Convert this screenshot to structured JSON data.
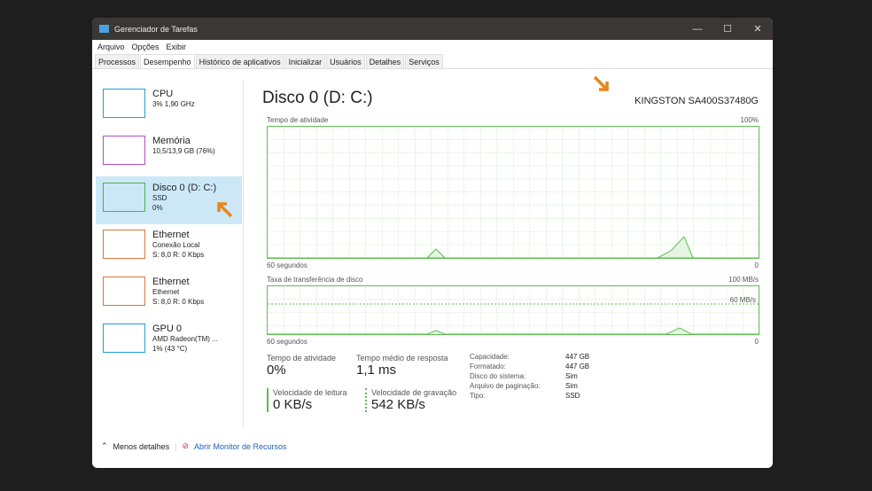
{
  "window": {
    "title": "Gerenciador de Tarefas",
    "controls": [
      "—",
      "☐",
      "✕"
    ]
  },
  "menu": [
    "Arquivo",
    "Opções",
    "Exibir"
  ],
  "tabs": [
    "Processos",
    "Desempenho",
    "Histórico de aplicativos",
    "Inicializar",
    "Usuários",
    "Detalhes",
    "Serviços"
  ],
  "sidebar": [
    {
      "title": "CPU",
      "l1": "3% 1,90 GHz",
      "l2": "",
      "color": "#1f9fd6"
    },
    {
      "title": "Memória",
      "l1": "10,5/13,9 GB (76%)",
      "l2": "",
      "color": "#b24cc8"
    },
    {
      "title": "Disco 0 (D: C:)",
      "l1": "SSD",
      "l2": "0%",
      "color": "#4caf50"
    },
    {
      "title": "Ethernet",
      "l1": "Conexão Local",
      "l2": "S: 8,0 R: 0 Kbps",
      "color": "#d9773a"
    },
    {
      "title": "Ethernet",
      "l1": "Ethernet",
      "l2": "S: 8,0 R: 0 Kbps",
      "color": "#d9773a"
    },
    {
      "title": "GPU 0",
      "l1": "AMD Radeon(TM) ...",
      "l2": "1% (43 °C)",
      "color": "#1f9fd6"
    }
  ],
  "main": {
    "title": "Disco 0 (D: C:)",
    "model": "KINGSTON SA400S37480G",
    "g1": {
      "label": "Tempo de atividade",
      "max": "100%",
      "xl": "60 segundos",
      "xr": "0"
    },
    "g2": {
      "label": "Taxa de transferência de disco",
      "max": "100 MB/s",
      "mid": "60 MB/s",
      "xl": "60 segundos",
      "xr": "0"
    },
    "stats": {
      "active_label": "Tempo de atividade",
      "active": "0%",
      "resp_label": "Tempo médio de resposta",
      "resp": "1,1 ms",
      "read_label": "Velocidade de leitura",
      "read": "0 KB/s",
      "write_label": "Velocidade de gravação",
      "write": "542 KB/s"
    },
    "props": [
      [
        "Capacidade:",
        "447 GB"
      ],
      [
        "Formatado:",
        "447 GB"
      ],
      [
        "Disco do sistema:",
        "Sim"
      ],
      [
        "Arquivo de paginação:",
        "Sim"
      ],
      [
        "Tipo:",
        "SSD"
      ]
    ]
  },
  "footer": {
    "less": "Menos detalhes",
    "monitor": "Abrir Monitor de Recursos"
  },
  "accent": "#e8861a"
}
